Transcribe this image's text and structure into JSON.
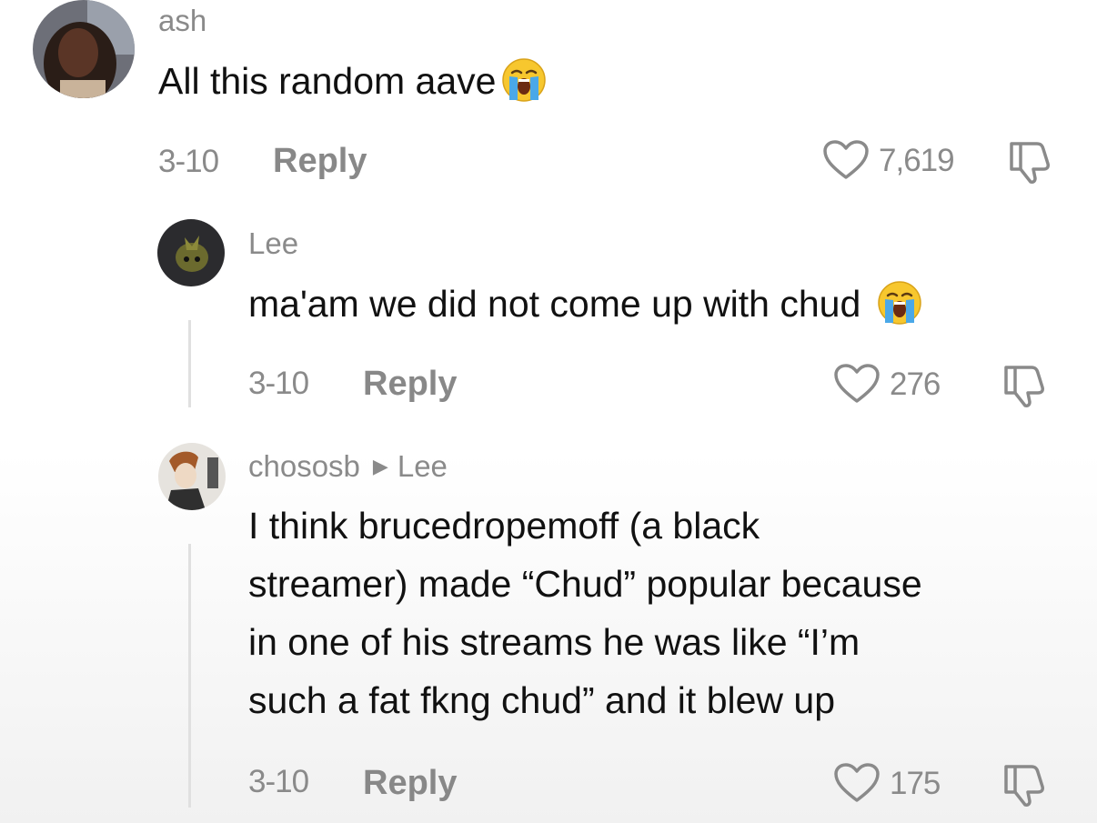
{
  "comments": [
    {
      "username": "ash",
      "text": "All this random aave",
      "emoji": "loudly-crying-face",
      "date": "3-10",
      "reply_label": "Reply",
      "like_count": "7,619"
    },
    {
      "username": "Lee",
      "text": "ma'am we did not come up with chud",
      "emoji": "loudly-crying-face",
      "date": "3-10",
      "reply_label": "Reply",
      "like_count": "276"
    },
    {
      "username": "chososb",
      "reply_to": "Lee",
      "text_lines": [
        "I think brucedropemoff (a black",
        "streamer) made “Chud” popular because",
        "in one of his streams he was like “I’m",
        "such a fat fkng chud” and it blew up"
      ],
      "date": "3-10",
      "reply_label": "Reply",
      "like_count": "175"
    }
  ],
  "colors": {
    "text": "#111111",
    "meta": "#8a8a8a",
    "thread_line": "#e0e0e0"
  }
}
